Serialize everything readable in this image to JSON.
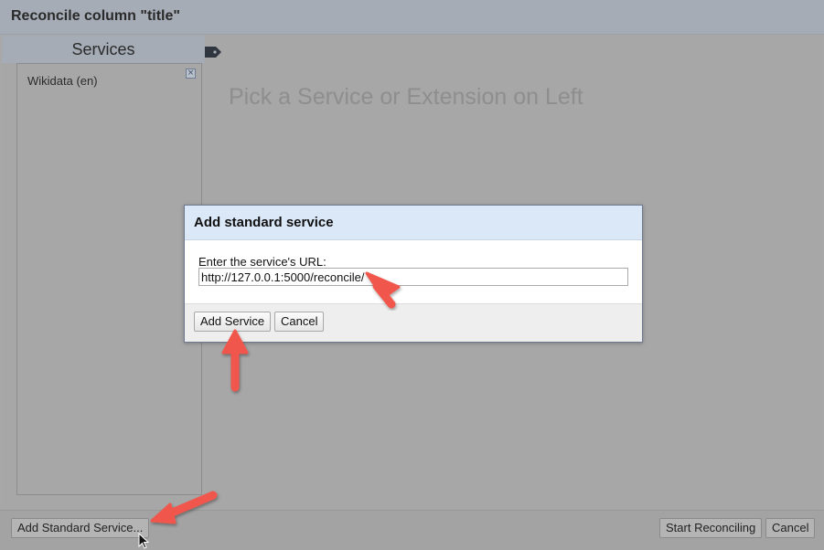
{
  "outer_dialog": {
    "title": "Reconcile column \"title\"",
    "services_header": "Services",
    "services": [
      {
        "label": "Wikidata (en)"
      }
    ],
    "remove_glyph": "×",
    "placeholder": "Pick a Service or Extension on Left",
    "footer": {
      "add_standard_label": "Add Standard Service...",
      "start_label": "Start Reconciling",
      "cancel_label": "Cancel"
    }
  },
  "modal": {
    "title": "Add standard service",
    "url_label": "Enter the service's URL:",
    "url_value": "http://127.0.0.1:5000/reconcile/",
    "add_label": "Add Service",
    "cancel_label": "Cancel"
  },
  "annotations": {
    "arrow_color": "#f0574b",
    "icons": [
      "tag-icon",
      "remove-icon",
      "annotation-arrow-icon",
      "mouse-pointer-icon"
    ]
  }
}
